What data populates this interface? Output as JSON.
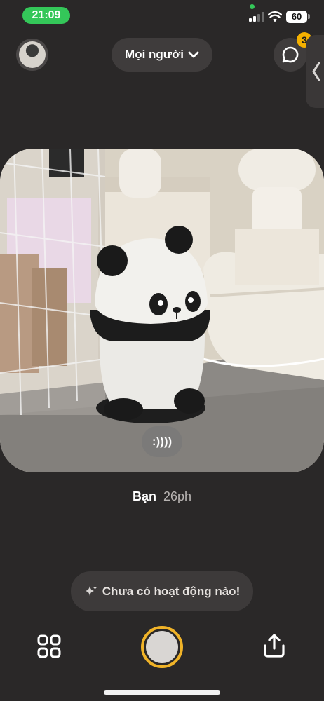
{
  "status_bar": {
    "time": "21:09",
    "battery": "60"
  },
  "header": {
    "audience_label": "Mọi người",
    "chat_badge_count": "3"
  },
  "post": {
    "reaction_text": ":))))",
    "author": "Bạn",
    "time_ago": "26ph"
  },
  "activity": {
    "text": "Chưa có hoạt động nào!"
  },
  "colors": {
    "background": "#2a2828",
    "accent": "#f0b328",
    "status_green": "#34c759",
    "badge": "#f5b100"
  },
  "icons": {
    "audience_chevron": "chevron-down-icon",
    "chat": "chat-bubble-icon",
    "side": "chevron-left-icon",
    "activity": "sparkle-icon",
    "grid": "grid-icon",
    "share": "share-icon"
  }
}
